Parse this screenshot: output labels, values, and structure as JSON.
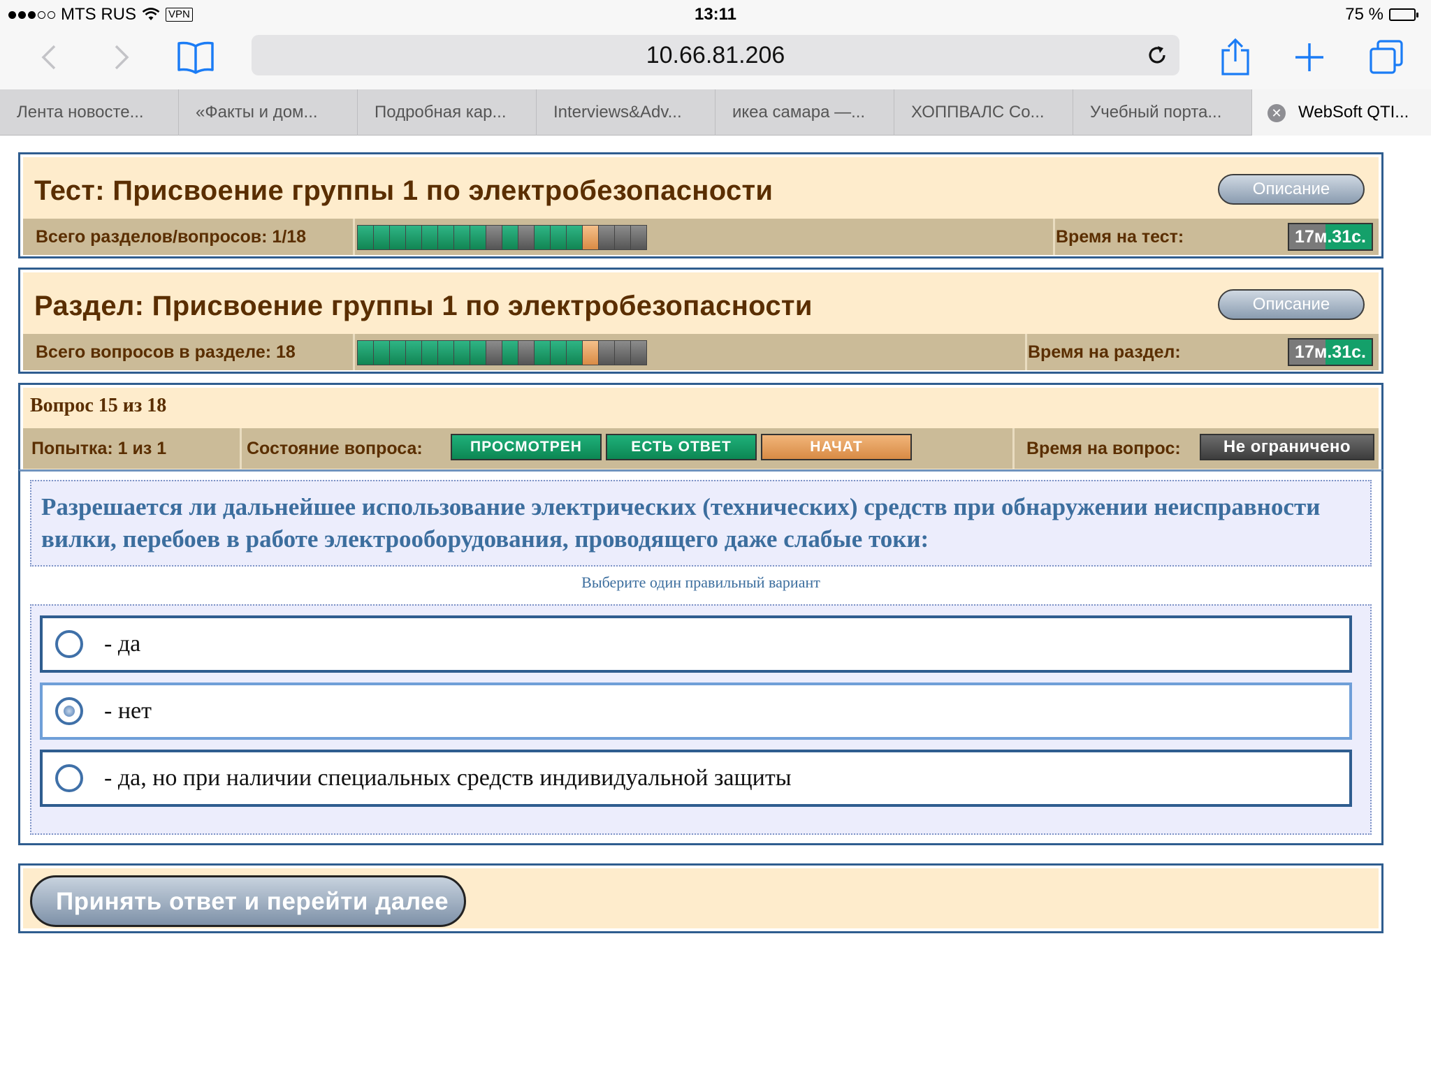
{
  "status_bar": {
    "carrier": "MTS RUS",
    "vpn": "VPN",
    "time": "13:11",
    "battery": "75 %",
    "battery_level": 0.75
  },
  "browser": {
    "url": "10.66.81.206",
    "tabs": [
      {
        "label": "Лента новосте..."
      },
      {
        "label": "«Факты и дом..."
      },
      {
        "label": "Подробная кар..."
      },
      {
        "label": "Interviews&Adv..."
      },
      {
        "label": "икеа самара —..."
      },
      {
        "label": "ХОППВАЛС Со..."
      },
      {
        "label": "Учебный порта..."
      },
      {
        "label": "WebSoft QTI..."
      }
    ],
    "icons": {
      "back": "chevron-left-icon",
      "forward": "chevron-right-icon",
      "bookmarks": "book-icon",
      "reload": "reload-icon",
      "share": "share-icon",
      "new_tab": "plus-icon",
      "tabs": "tabs-icon",
      "close_tab": "close-icon"
    }
  },
  "test": {
    "title": "Тест: Присвоение группы 1 по электробезопасности",
    "description_button": "Описание",
    "count_label": "Всего разделов/вопросов: 1/18",
    "time_label": "Время на тест:",
    "timer": "17м.31с.",
    "progress": [
      "done",
      "done",
      "done",
      "done",
      "done",
      "done",
      "done",
      "done",
      "skipped",
      "done",
      "skipped",
      "done",
      "done",
      "done",
      "current",
      "pending",
      "pending",
      "pending"
    ]
  },
  "section": {
    "title": "Раздел: Присвоение группы 1 по электробезопасности",
    "description_button": "Описание",
    "count_label": "Всего вопросов в разделе: 18",
    "time_label": "Время на раздел:",
    "timer": "17м.31с.",
    "progress": [
      "done",
      "done",
      "done",
      "done",
      "done",
      "done",
      "done",
      "done",
      "skipped",
      "done",
      "skipped",
      "done",
      "done",
      "done",
      "current",
      "pending",
      "pending",
      "pending"
    ]
  },
  "question": {
    "number_label": "Вопрос 15 из 18",
    "attempt_label": "Попытка: 1 из 1",
    "state_label": "Состояние вопроса:",
    "states": [
      "ПРОСМОТРЕН",
      "ЕСТЬ ОТВЕТ",
      "НАЧАТ"
    ],
    "time_label": "Время на вопрос:",
    "time_value": "Не ограничено",
    "text": "Разрешается ли дальнейшее использование электрических (технических) средств при обнаружении неисправности вилки, перебоев в работе электрооборудования, проводящего даже слабые токи:",
    "hint": "Выберите один правильный вариант",
    "options": [
      {
        "label": "- да",
        "selected": false
      },
      {
        "label": "- нет",
        "selected": true
      },
      {
        "label": "- да, но при наличии специальных средств индивидуальной защиты",
        "selected": false
      }
    ]
  },
  "submit_button": "Принять ответ и перейти далее",
  "colors": {
    "panel_border": "#2f5d8f",
    "panel_bg": "#feeccc",
    "bar_bg": "#cbbb98",
    "heading_text": "#5a2e00",
    "question_text": "#3c6e9e",
    "progress_done": "#14a06a",
    "progress_pending": "#6b6b6b",
    "progress_current": "#e6a262"
  }
}
